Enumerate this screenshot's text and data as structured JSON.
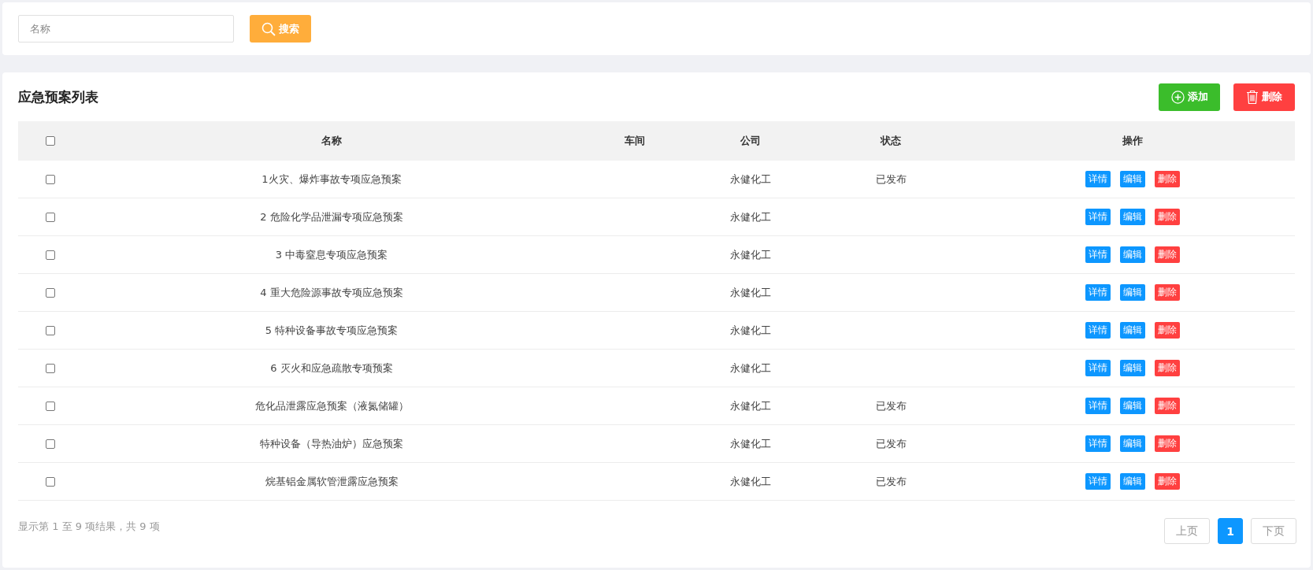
{
  "search": {
    "placeholder": "名称",
    "button": "搜索"
  },
  "list": {
    "title": "应急预案列表",
    "actions": [
      {
        "kind": "add",
        "label": "添加"
      },
      {
        "kind": "delete",
        "label": "删除"
      }
    ]
  },
  "table": {
    "select_all": {
      "checked": false
    },
    "columns": [
      "名称",
      "车间",
      "公司",
      "状态",
      "操作"
    ],
    "rows": [
      {
        "checked": false,
        "name": "1火灾、爆炸事故专项应急预案",
        "company": "永健化工",
        "status": "已发布",
        "actions": [
          "详情",
          "编辑",
          "删除"
        ]
      },
      {
        "checked": false,
        "name": "2 危险化学品泄漏专项应急预案",
        "company": "永健化工",
        "status": "",
        "actions": [
          "详情",
          "编辑",
          "删除"
        ]
      },
      {
        "checked": false,
        "name": "3 中毒窒息专项应急预案",
        "company": "永健化工",
        "status": "",
        "actions": [
          "详情",
          "编辑",
          "删除"
        ]
      },
      {
        "checked": false,
        "name": "4 重大危险源事故专项应急预案",
        "company": "永健化工",
        "status": "",
        "actions": [
          "详情",
          "编辑",
          "删除"
        ]
      },
      {
        "checked": false,
        "name": "5 特种设备事故专项应急预案",
        "company": "永健化工",
        "status": "",
        "actions": [
          "详情",
          "编辑",
          "删除"
        ]
      },
      {
        "checked": false,
        "name": "6 灭火和应急疏散专项预案",
        "company": "永健化工",
        "status": "",
        "actions": [
          "详情",
          "编辑",
          "删除"
        ]
      },
      {
        "checked": false,
        "name": "危化品泄露应急预案（液氮储罐）",
        "company": "永健化工",
        "status": "已发布",
        "actions": [
          "详情",
          "编辑",
          "删除"
        ]
      },
      {
        "checked": false,
        "name": "特种设备（导热油炉）应急预案",
        "company": "永健化工",
        "status": "已发布",
        "actions": [
          "详情",
          "编辑",
          "删除"
        ]
      },
      {
        "checked": false,
        "name": "烷基铝金属软管泄露应急预案",
        "company": "永健化工",
        "status": "已发布",
        "actions": [
          "详情",
          "编辑",
          "删除"
        ]
      }
    ]
  },
  "footer": {
    "summary": "显示第 1 至 9 项结果，共 9 项",
    "pagination": [
      {
        "label": "上页",
        "kind": "nav",
        "selected": false
      },
      {
        "label": "1",
        "kind": "page",
        "selected": true
      },
      {
        "label": "下页",
        "kind": "nav",
        "selected": false
      }
    ]
  }
}
